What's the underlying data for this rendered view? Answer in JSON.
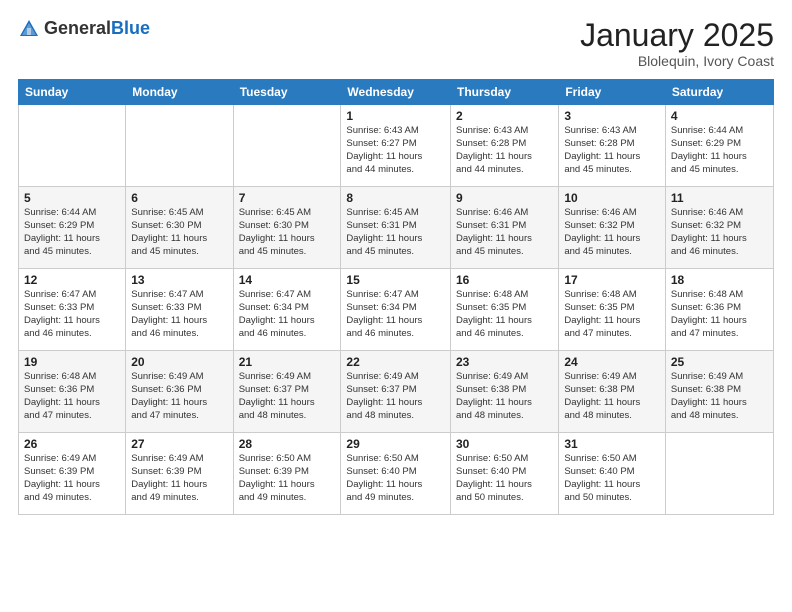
{
  "header": {
    "logo_general": "General",
    "logo_blue": "Blue",
    "title": "January 2025",
    "location": "Blolequin, Ivory Coast"
  },
  "weekdays": [
    "Sunday",
    "Monday",
    "Tuesday",
    "Wednesday",
    "Thursday",
    "Friday",
    "Saturday"
  ],
  "weeks": [
    [
      {
        "day": "",
        "info": ""
      },
      {
        "day": "",
        "info": ""
      },
      {
        "day": "",
        "info": ""
      },
      {
        "day": "1",
        "info": "Sunrise: 6:43 AM\nSunset: 6:27 PM\nDaylight: 11 hours\nand 44 minutes."
      },
      {
        "day": "2",
        "info": "Sunrise: 6:43 AM\nSunset: 6:28 PM\nDaylight: 11 hours\nand 44 minutes."
      },
      {
        "day": "3",
        "info": "Sunrise: 6:43 AM\nSunset: 6:28 PM\nDaylight: 11 hours\nand 45 minutes."
      },
      {
        "day": "4",
        "info": "Sunrise: 6:44 AM\nSunset: 6:29 PM\nDaylight: 11 hours\nand 45 minutes."
      }
    ],
    [
      {
        "day": "5",
        "info": "Sunrise: 6:44 AM\nSunset: 6:29 PM\nDaylight: 11 hours\nand 45 minutes."
      },
      {
        "day": "6",
        "info": "Sunrise: 6:45 AM\nSunset: 6:30 PM\nDaylight: 11 hours\nand 45 minutes."
      },
      {
        "day": "7",
        "info": "Sunrise: 6:45 AM\nSunset: 6:30 PM\nDaylight: 11 hours\nand 45 minutes."
      },
      {
        "day": "8",
        "info": "Sunrise: 6:45 AM\nSunset: 6:31 PM\nDaylight: 11 hours\nand 45 minutes."
      },
      {
        "day": "9",
        "info": "Sunrise: 6:46 AM\nSunset: 6:31 PM\nDaylight: 11 hours\nand 45 minutes."
      },
      {
        "day": "10",
        "info": "Sunrise: 6:46 AM\nSunset: 6:32 PM\nDaylight: 11 hours\nand 45 minutes."
      },
      {
        "day": "11",
        "info": "Sunrise: 6:46 AM\nSunset: 6:32 PM\nDaylight: 11 hours\nand 46 minutes."
      }
    ],
    [
      {
        "day": "12",
        "info": "Sunrise: 6:47 AM\nSunset: 6:33 PM\nDaylight: 11 hours\nand 46 minutes."
      },
      {
        "day": "13",
        "info": "Sunrise: 6:47 AM\nSunset: 6:33 PM\nDaylight: 11 hours\nand 46 minutes."
      },
      {
        "day": "14",
        "info": "Sunrise: 6:47 AM\nSunset: 6:34 PM\nDaylight: 11 hours\nand 46 minutes."
      },
      {
        "day": "15",
        "info": "Sunrise: 6:47 AM\nSunset: 6:34 PM\nDaylight: 11 hours\nand 46 minutes."
      },
      {
        "day": "16",
        "info": "Sunrise: 6:48 AM\nSunset: 6:35 PM\nDaylight: 11 hours\nand 46 minutes."
      },
      {
        "day": "17",
        "info": "Sunrise: 6:48 AM\nSunset: 6:35 PM\nDaylight: 11 hours\nand 47 minutes."
      },
      {
        "day": "18",
        "info": "Sunrise: 6:48 AM\nSunset: 6:36 PM\nDaylight: 11 hours\nand 47 minutes."
      }
    ],
    [
      {
        "day": "19",
        "info": "Sunrise: 6:48 AM\nSunset: 6:36 PM\nDaylight: 11 hours\nand 47 minutes."
      },
      {
        "day": "20",
        "info": "Sunrise: 6:49 AM\nSunset: 6:36 PM\nDaylight: 11 hours\nand 47 minutes."
      },
      {
        "day": "21",
        "info": "Sunrise: 6:49 AM\nSunset: 6:37 PM\nDaylight: 11 hours\nand 48 minutes."
      },
      {
        "day": "22",
        "info": "Sunrise: 6:49 AM\nSunset: 6:37 PM\nDaylight: 11 hours\nand 48 minutes."
      },
      {
        "day": "23",
        "info": "Sunrise: 6:49 AM\nSunset: 6:38 PM\nDaylight: 11 hours\nand 48 minutes."
      },
      {
        "day": "24",
        "info": "Sunrise: 6:49 AM\nSunset: 6:38 PM\nDaylight: 11 hours\nand 48 minutes."
      },
      {
        "day": "25",
        "info": "Sunrise: 6:49 AM\nSunset: 6:38 PM\nDaylight: 11 hours\nand 48 minutes."
      }
    ],
    [
      {
        "day": "26",
        "info": "Sunrise: 6:49 AM\nSunset: 6:39 PM\nDaylight: 11 hours\nand 49 minutes."
      },
      {
        "day": "27",
        "info": "Sunrise: 6:49 AM\nSunset: 6:39 PM\nDaylight: 11 hours\nand 49 minutes."
      },
      {
        "day": "28",
        "info": "Sunrise: 6:50 AM\nSunset: 6:39 PM\nDaylight: 11 hours\nand 49 minutes."
      },
      {
        "day": "29",
        "info": "Sunrise: 6:50 AM\nSunset: 6:40 PM\nDaylight: 11 hours\nand 49 minutes."
      },
      {
        "day": "30",
        "info": "Sunrise: 6:50 AM\nSunset: 6:40 PM\nDaylight: 11 hours\nand 50 minutes."
      },
      {
        "day": "31",
        "info": "Sunrise: 6:50 AM\nSunset: 6:40 PM\nDaylight: 11 hours\nand 50 minutes."
      },
      {
        "day": "",
        "info": ""
      }
    ]
  ]
}
